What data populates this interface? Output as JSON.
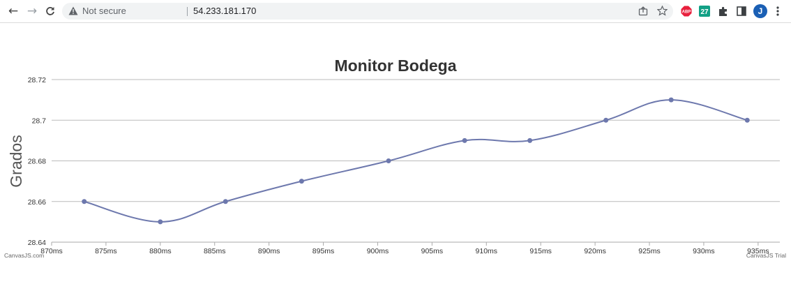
{
  "browser": {
    "security_label": "Not secure",
    "url": "54.233.181.170",
    "profile_initial": "J",
    "abp_label": "ABP",
    "ext27_label": "27"
  },
  "icons": [
    "back-arrow-icon",
    "forward-arrow-icon",
    "reload-icon",
    "warning-icon",
    "share-icon",
    "star-icon",
    "abp-icon",
    "ext-27-icon",
    "puzzle-icon",
    "side-panel-icon",
    "avatar",
    "kebab-menu-icon"
  ],
  "colors": {
    "series": "#6D78AD",
    "grid": "#BBBBBB",
    "text": "#333333",
    "abp": "#e8203d",
    "ext27": "#12a085",
    "avatar": "#1a5fb4"
  },
  "chart_data": {
    "type": "line",
    "title": "Monitor Bodega",
    "ylabel": "Grados",
    "xlabel": "",
    "x_ticks": [
      "870ms",
      "875ms",
      "880ms",
      "885ms",
      "890ms",
      "895ms",
      "900ms",
      "905ms",
      "910ms",
      "915ms",
      "920ms",
      "925ms",
      "930ms",
      "935ms"
    ],
    "x_tick_values": [
      870,
      875,
      880,
      885,
      890,
      895,
      900,
      905,
      910,
      915,
      920,
      925,
      930,
      935
    ],
    "y_ticks": [
      "28.64",
      "28.66",
      "28.68",
      "28.7",
      "28.72"
    ],
    "y_tick_values": [
      28.64,
      28.66,
      28.68,
      28.7,
      28.72
    ],
    "xlim": [
      870,
      937
    ],
    "ylim": [
      28.64,
      28.72
    ],
    "grid": "horizontal",
    "smooth": true,
    "series": [
      {
        "x": [
          873,
          880,
          886,
          893,
          901,
          908,
          914,
          921,
          927,
          934
        ],
        "values": [
          28.66,
          28.65,
          28.66,
          28.67,
          28.68,
          28.69,
          28.69,
          28.7,
          28.71,
          28.7
        ]
      }
    ],
    "credit_left": "CanvasJS.com",
    "credit_right": "CanvasJS Trial"
  }
}
